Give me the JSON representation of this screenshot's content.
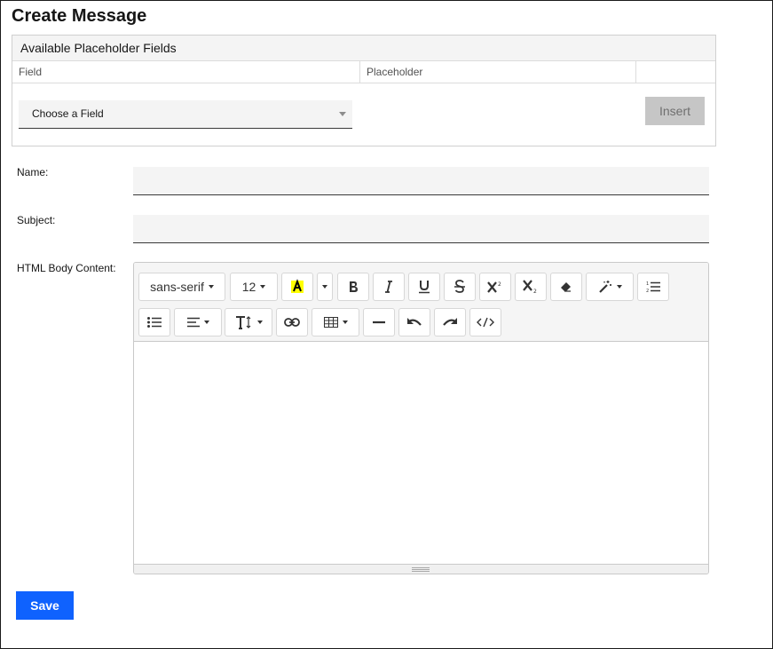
{
  "page": {
    "title": "Create Message"
  },
  "placeholder_panel": {
    "title": "Available Placeholder Fields",
    "columns": [
      "Field",
      "Placeholder",
      ""
    ],
    "select_value": "Choose a Field",
    "insert_label": "Insert"
  },
  "form": {
    "name_label": "Name:",
    "name_value": "",
    "subject_label": "Subject:",
    "subject_value": "",
    "body_label": "HTML Body Content:",
    "save_label": "Save"
  },
  "editor": {
    "font_family": "sans-serif",
    "font_size": "12",
    "highlight_color": "#ffff00",
    "toolbar_icons": [
      "font-family-dropdown",
      "font-size-dropdown",
      "highlight-color-icon",
      "color-dropdown-caret",
      "bold-icon",
      "italic-icon",
      "underline-icon",
      "strikethrough-icon",
      "superscript-icon",
      "subscript-icon",
      "eraser-icon",
      "magic-wand-icon",
      "ordered-list-icon",
      "unordered-list-icon",
      "align-icon",
      "line-height-icon",
      "link-icon",
      "table-icon",
      "horizontal-rule-icon",
      "undo-icon",
      "redo-icon",
      "code-view-icon"
    ]
  },
  "colors": {
    "primary": "#0f62fe",
    "field_bg": "#f4f4f4",
    "disabled": "#c6c6c6"
  }
}
